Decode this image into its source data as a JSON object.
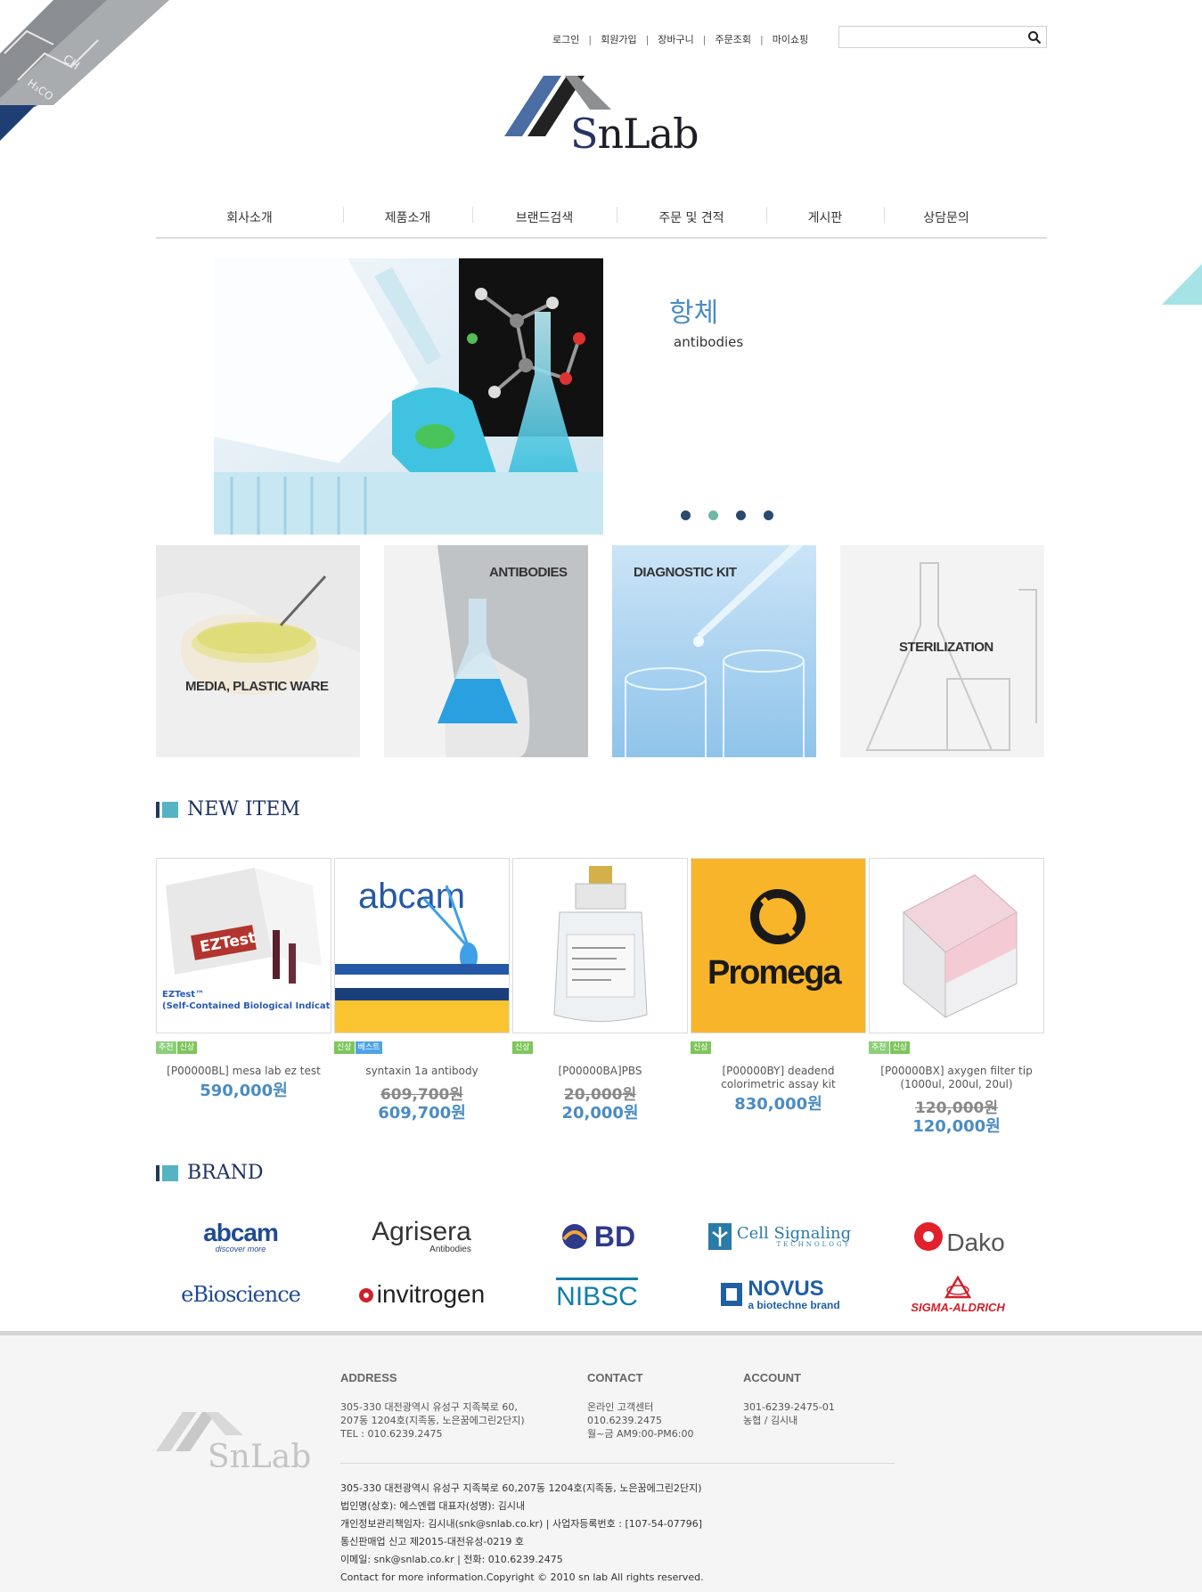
{
  "util_links": [
    "로그인",
    "회원가입",
    "장바구니",
    "주문조회",
    "마이쇼핑"
  ],
  "search": {
    "placeholder": ""
  },
  "logo": {
    "s": "S",
    "rest": "nLab"
  },
  "nav": [
    "회사소개",
    "제품소개",
    "브랜드검색",
    "주문 및 견적",
    "게시판",
    "상담문의"
  ],
  "hero": {
    "title": "항체",
    "subtitle": "antibodies",
    "slides": 4,
    "active_slide": 2
  },
  "tiles": [
    "MEDIA, PLASTIC WARE",
    "ANTIBODIES",
    "DIAGNOSTIC KIT",
    "STERILIZATION"
  ],
  "new_item_title": "NEW ITEM",
  "products": [
    {
      "badges": [
        [
          "추천",
          "rec"
        ],
        [
          "신상",
          "new"
        ]
      ],
      "name": "[P00000BL] mesa lab ez test",
      "price_old": "",
      "price": "590,000원"
    },
    {
      "badges": [
        [
          "신상",
          "new"
        ],
        [
          "베스트",
          "best"
        ]
      ],
      "name": "syntaxin 1a antibody",
      "price_old": "609,700원",
      "price": "609,700원"
    },
    {
      "badges": [
        [
          "신상",
          "new"
        ]
      ],
      "name": "[P00000BA]PBS",
      "price_old": "20,000원",
      "price": "20,000원"
    },
    {
      "badges": [
        [
          "신상",
          "new"
        ]
      ],
      "name": "[P00000BY] deadend colorimetric assay kit",
      "price_old": "",
      "price": "830,000원"
    },
    {
      "badges": [
        [
          "추천",
          "rec"
        ],
        [
          "신상",
          "new"
        ]
      ],
      "name": "[P00000BX] axygen filter tip (1000ul, 200ul, 20ul)",
      "price_old": "120,000원",
      "price": "120,000원"
    }
  ],
  "product_images": {
    "ez_title": "EZTest",
    "ez_caption": "EZTest™\n(Self-Contained Biological Indicators)",
    "abcam": "abcam",
    "promega": "Promega"
  },
  "brand_title": "BRAND",
  "brands": {
    "abcam": "abcam",
    "abcam_tag": "discover more",
    "agrisera": "Agrisera",
    "agrisera_tag": "Antibodies",
    "bd": "BD",
    "cell_signaling": "Cell Signaling",
    "cell_signaling_tag": "TECHNOLOGY",
    "dako": "Dako",
    "ebioscience": "eBioscience",
    "invitrogen": "invitrogen",
    "nibsc": "NIBSC",
    "novus": "NOVUS",
    "novus_tag": "a biotechne brand",
    "sigma": "SIGMA-ALDRICH"
  },
  "footer": {
    "address_title": "ADDRESS",
    "address_text": "305-330 대전광역시 유성구 지족북로 60,\n207동 1204호(지족동, 노은꿈에그린2단지)\nTEL : 010.6239.2475",
    "contact_title": "CONTACT",
    "contact_text": "온라인 고객센터\n010.6239.2475\n월~금 AM9:00-PM6:00",
    "account_title": "ACCOUNT",
    "account_text": "301-6239-2475-01\n농협 / 김시내",
    "info_lines": [
      "305-330 대전광역시 유성구 지족북로 60,207동 1204호(지족동, 노은꿈에그린2단지)",
      "법인명(상호): 에스엔랩 대표자(성명): 김시내",
      "개인정보관리책임자: 김시내(snk@snlab.co.kr) | 사업자등록번호 : [107-54-07796]",
      "통신판매업 신고 제2015-대전유성-0219 호",
      "이메일: snk@snlab.co.kr | 전화: 010.6239.2475",
      "Contact for more information.Copyright © 2010 sn lab All rights reserved."
    ],
    "logo_text": "SnLab"
  },
  "colors": {
    "accent": "#4a8cc2",
    "navy": "#1e3360",
    "teal": "#56b3c1"
  }
}
